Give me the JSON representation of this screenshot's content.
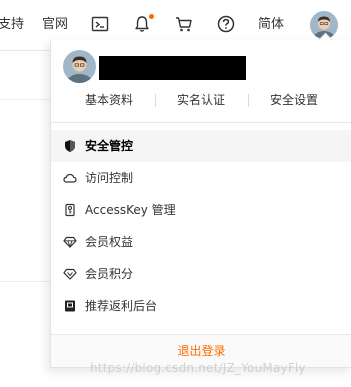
{
  "topbar": {
    "support_label": "支持",
    "official_label": "官网",
    "terminal_icon": "terminal-icon",
    "bell_icon": "bell-icon",
    "cart_icon": "cart-icon",
    "help_icon": "help-icon",
    "lang_label": "简体",
    "avatar_icon": "user-avatar"
  },
  "profile": {
    "username": "",
    "links": [
      "基本资料",
      "实名认证",
      "安全设置"
    ]
  },
  "menu": {
    "items": [
      {
        "label": "安全管控",
        "icon": "shield-icon"
      },
      {
        "label": "访问控制",
        "icon": "cloud-icon"
      },
      {
        "label": "AccessKey 管理",
        "icon": "key-icon"
      },
      {
        "label": "会员权益",
        "icon": "diamond-icon"
      },
      {
        "label": "会员积分",
        "icon": "diamond-outline-icon"
      },
      {
        "label": "推荐返利后台",
        "icon": "card-icon"
      }
    ]
  },
  "logout_label": "退出登录",
  "watermark": "https://blog.csdn.net/JZ_YouMayFly",
  "colors": {
    "accent": "#ff6a00",
    "text": "#333333",
    "active_bg": "#f5f5f5",
    "notification_dot": "#ff6a00"
  }
}
